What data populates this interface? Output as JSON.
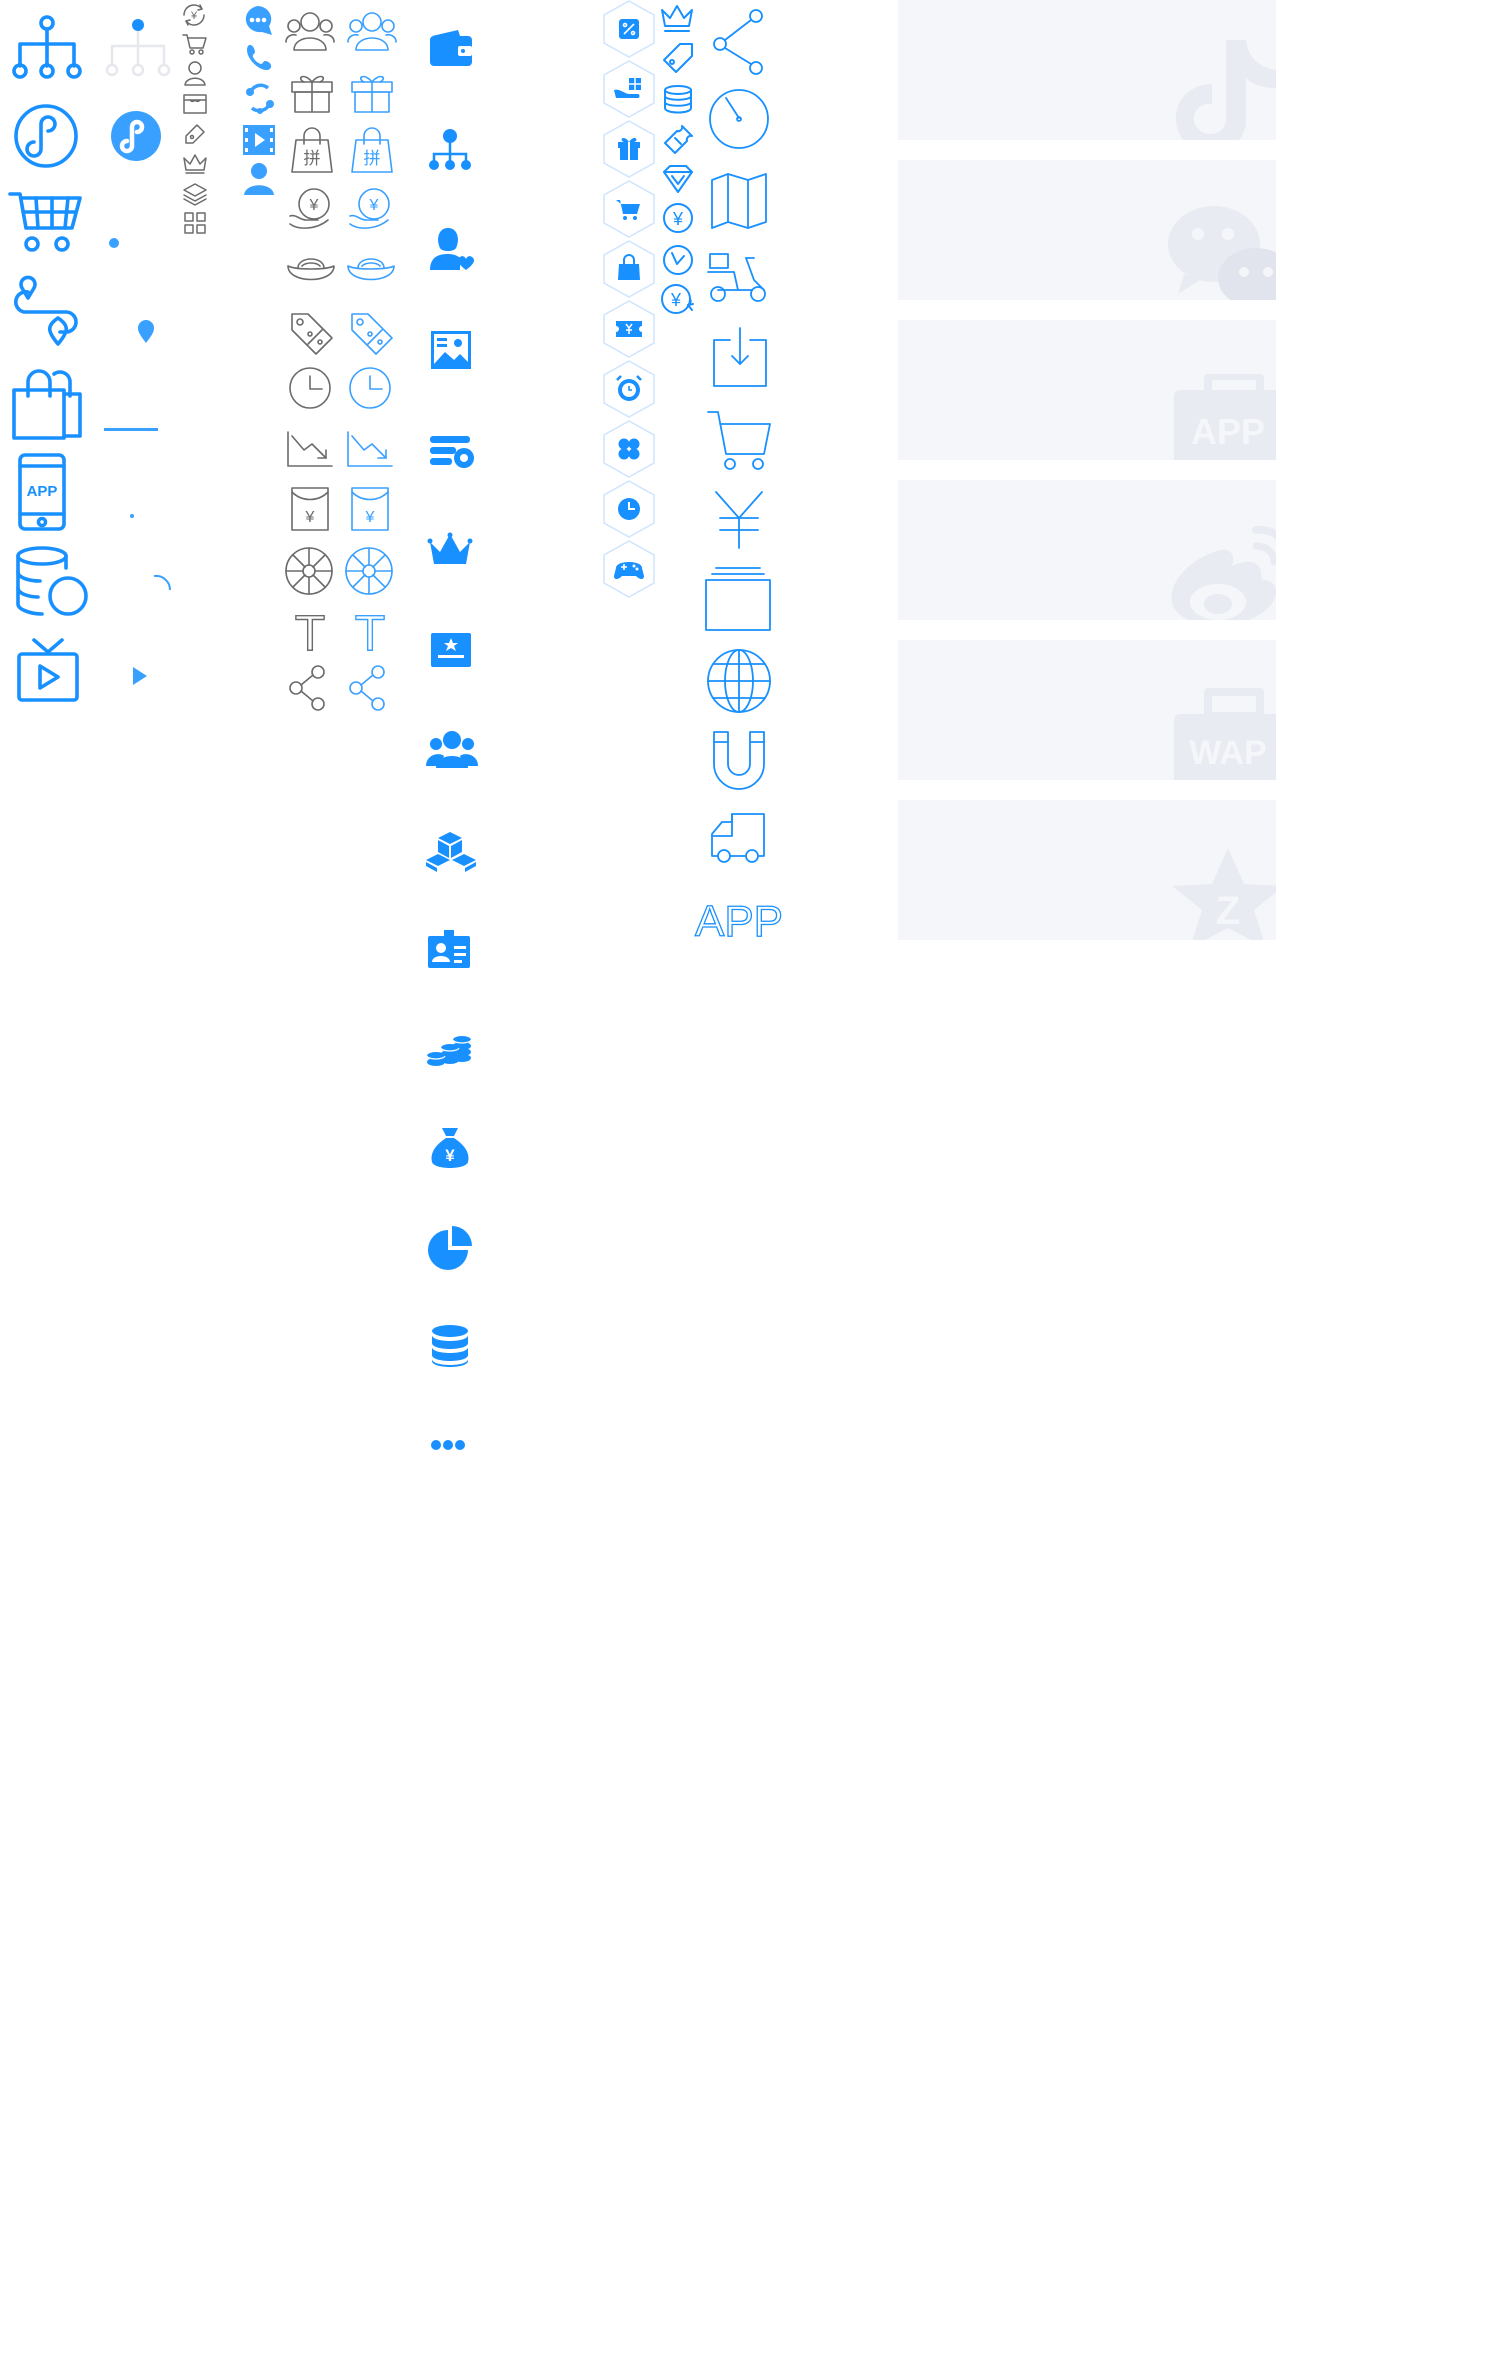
{
  "colors": {
    "primary": "#1890ff",
    "light": "#3aa0ff",
    "grey": "#6b6b6b",
    "card_bg": "#f5f6fa",
    "watermark": "#e9ebf2"
  },
  "icons": {
    "col_a": [
      "org-tree-icon",
      "mini-program-icon",
      "shopping-cart-icon",
      "route-location-icon",
      "shopping-bags-icon",
      "mobile-app-icon",
      "database-sync-icon",
      "tv-play-icon"
    ],
    "col_b": [
      "org-tree-faded-icon",
      "mini-program-filled-icon",
      "dot-icon",
      "location-pin-icon",
      "line-divider-icon",
      "small-dot-icon",
      "arc-icon",
      "play-triangle-icon"
    ],
    "col_tiny": [
      "yuan-refresh-icon",
      "cart-small-icon",
      "user-small-icon",
      "store-small-icon",
      "tag-edit-icon",
      "crown-small-icon",
      "layers-icon",
      "grid-apps-icon"
    ],
    "col_social": [
      "chat-bubble-icon",
      "phone-icon",
      "share-circle-icon",
      "video-film-icon",
      "person-service-icon"
    ],
    "col_pairs": [
      "user-group-icon",
      "gift-box-icon",
      "group-buy-bag-icon",
      "yuan-hand-icon",
      "gold-ingot-icon",
      "discount-tag-icon",
      "clock-icon",
      "trend-down-icon",
      "red-envelope-icon",
      "wheel-icon",
      "text-tool-icon",
      "share-nodes-icon"
    ],
    "col_solid": [
      "wallet-icon",
      "org-solid-icon",
      "user-heart-icon",
      "picture-icon",
      "card-settings-icon",
      "crown-icon",
      "certificate-icon",
      "team-icon",
      "boxes-icon",
      "id-card-icon",
      "coins-icon",
      "money-bag-icon",
      "pie-chart-icon",
      "database-icon",
      "more-dots-icon"
    ],
    "col_hex": [
      "hex-discount-icon",
      "hex-hand-gift-icon",
      "hex-gift-icon",
      "hex-cart-icon",
      "hex-bag-icon",
      "hex-ticket-icon",
      "hex-alarm-icon",
      "hex-clover-icon",
      "hex-clock-icon",
      "hex-gamepad-icon"
    ],
    "col_small": [
      "crown-outline-icon",
      "tag-outline-icon",
      "coin-stack-icon",
      "coupon-icon",
      "diamond-icon",
      "yuan-circle-icon",
      "clock-check-icon",
      "yuan-refresh-icon"
    ],
    "col_large": [
      "share-large-icon",
      "speedometer-icon",
      "map-icon",
      "scooter-icon",
      "download-tray-icon",
      "cart-large-icon",
      "yuan-large-icon",
      "folder-stack-icon",
      "globe-icon",
      "magnet-icon",
      "truck-icon",
      "app-text-icon"
    ],
    "cards": [
      "tiktok-icon",
      "wechat-icon",
      "app-badge-icon",
      "weibo-icon",
      "wap-badge-icon",
      "qzone-icon"
    ]
  },
  "labels": {
    "app": "APP",
    "app_badge": "APP",
    "wap_badge": "WAP",
    "app_text": "APP",
    "pin": "拼",
    "yuan": "¥",
    "t": "T",
    "qzone": "Z"
  }
}
